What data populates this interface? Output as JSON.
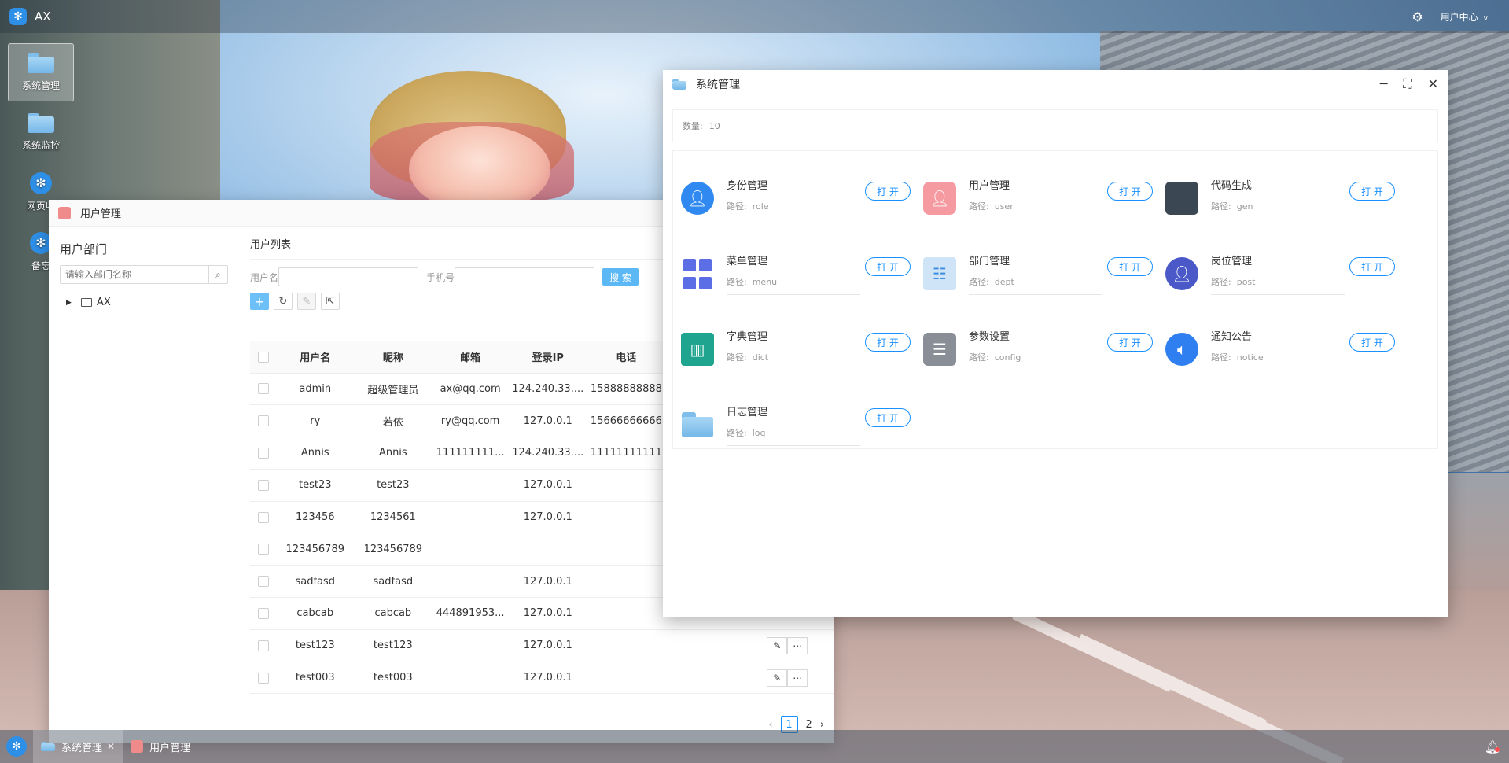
{
  "topbar": {
    "app_name": "AX",
    "user_menu": "用户中心"
  },
  "desktop_icons": [
    {
      "label": "系统管理"
    },
    {
      "label": "系统监控"
    },
    {
      "label": "网页收"
    },
    {
      "label": "备忘"
    }
  ],
  "user_window": {
    "title": "用户管理",
    "dept_title": "用户部门",
    "dept_search_placeholder": "请输入部门名称",
    "tree_root": "AX",
    "list_title": "用户列表",
    "filter_username_label": "用户名",
    "filter_phone_label": "手机号",
    "search_button": "搜 索",
    "columns": [
      "用户名",
      "昵称",
      "邮箱",
      "登录IP",
      "电话"
    ],
    "rows": [
      {
        "username": "admin",
        "nickname": "超级管理员",
        "email": "ax@qq.com",
        "ip": "124.240.33....",
        "phone": "15888888888"
      },
      {
        "username": "ry",
        "nickname": "若依",
        "email": "ry@qq.com",
        "ip": "127.0.0.1",
        "phone": "15666666666"
      },
      {
        "username": "Annis",
        "nickname": "Annis",
        "email": "111111111...",
        "ip": "124.240.33....",
        "phone": "11111111111"
      },
      {
        "username": "test23",
        "nickname": "test23",
        "email": "",
        "ip": "127.0.0.1",
        "phone": ""
      },
      {
        "username": "123456",
        "nickname": "1234561",
        "email": "",
        "ip": "127.0.0.1",
        "phone": ""
      },
      {
        "username": "123456789",
        "nickname": "123456789",
        "email": "",
        "ip": "",
        "phone": ""
      },
      {
        "username": "sadfasd",
        "nickname": "sadfasd",
        "email": "",
        "ip": "127.0.0.1",
        "phone": ""
      },
      {
        "username": "cabcab",
        "nickname": "cabcab",
        "email": "444891953...",
        "ip": "127.0.0.1",
        "phone": ""
      },
      {
        "username": "test123",
        "nickname": "test123",
        "email": "",
        "ip": "127.0.0.1",
        "phone": ""
      },
      {
        "username": "test003",
        "nickname": "test003",
        "email": "",
        "ip": "127.0.0.1",
        "phone": ""
      }
    ],
    "pager": {
      "current": "1",
      "next_page": "2"
    }
  },
  "sys_window": {
    "title": "系统管理",
    "count_label": "数量:",
    "count_value": "10",
    "path_label": "路径:",
    "open_label": "打 开",
    "modules": [
      {
        "name": "身份管理",
        "path": "role",
        "icon": "user-circle-icon"
      },
      {
        "name": "用户管理",
        "path": "user",
        "icon": "user-pink-icon"
      },
      {
        "name": "代码生成",
        "path": "gen",
        "icon": "code-icon"
      },
      {
        "name": "菜单管理",
        "path": "menu",
        "icon": "grid-icon"
      },
      {
        "name": "部门管理",
        "path": "dept",
        "icon": "org-chart-icon"
      },
      {
        "name": "岗位管理",
        "path": "post",
        "icon": "person-badge-icon"
      },
      {
        "name": "字典管理",
        "path": "dict",
        "icon": "book-icon"
      },
      {
        "name": "参数设置",
        "path": "config",
        "icon": "sliders-icon"
      },
      {
        "name": "通知公告",
        "path": "notice",
        "icon": "speaker-icon"
      },
      {
        "name": "日志管理",
        "path": "log",
        "icon": "folder-icon"
      }
    ]
  },
  "taskbar": {
    "items": [
      {
        "label": "系统管理"
      },
      {
        "label": "用户管理"
      }
    ]
  }
}
